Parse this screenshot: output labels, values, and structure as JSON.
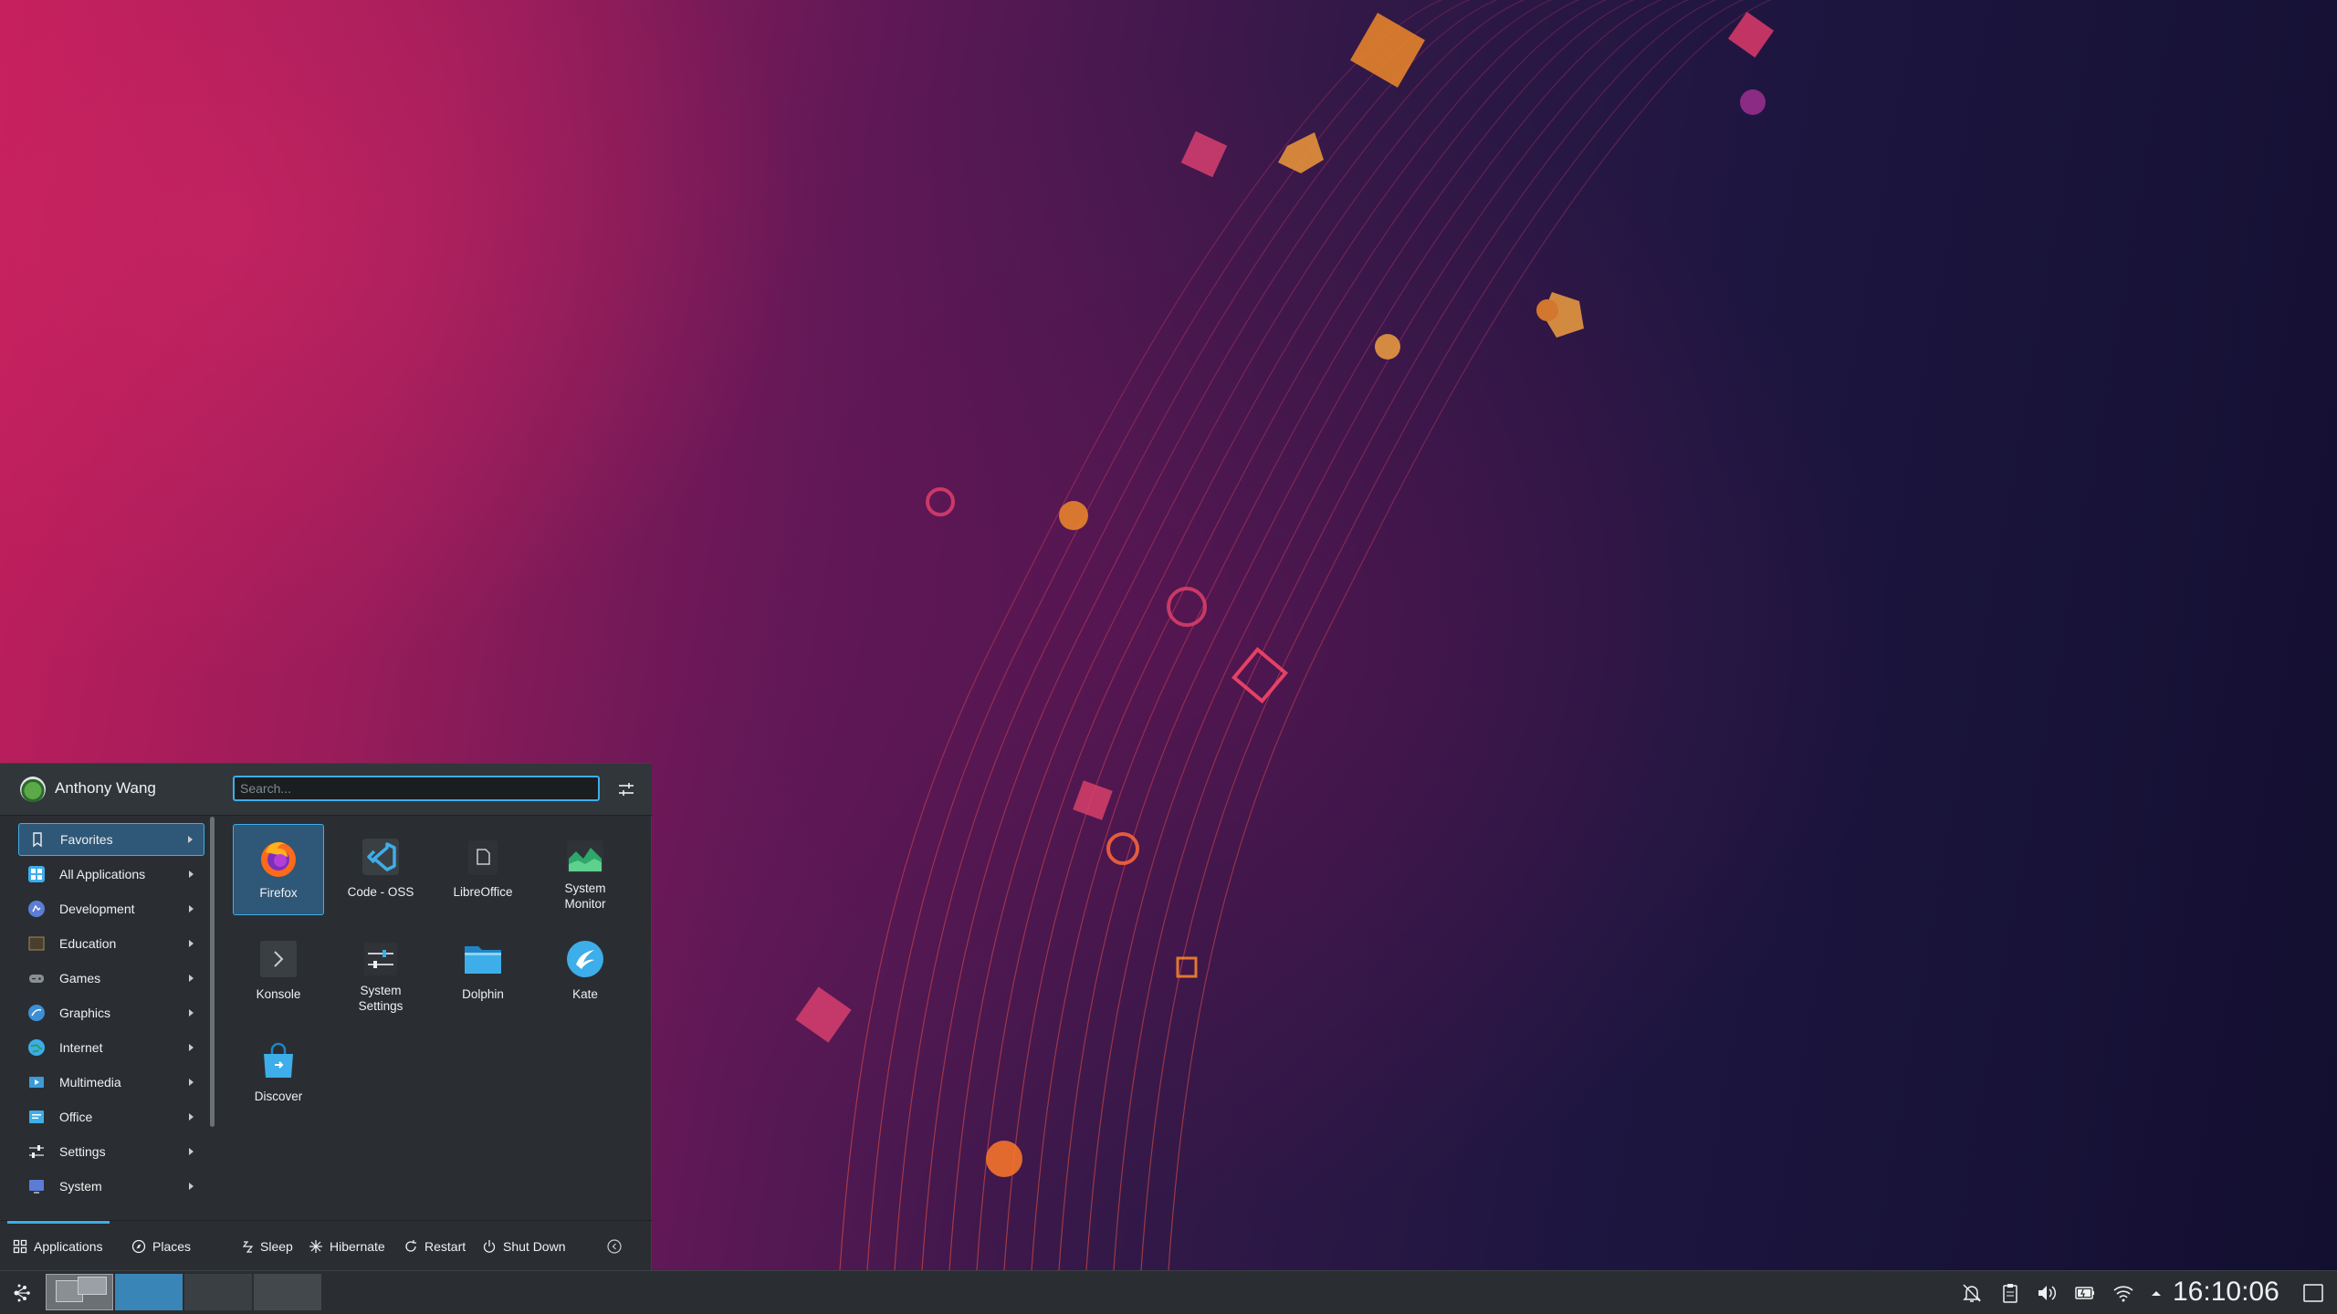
{
  "user": {
    "name": "Anthony Wang"
  },
  "search": {
    "placeholder": "Search..."
  },
  "categories": [
    {
      "label": "Favorites",
      "icon": "bookmark-icon",
      "color": "#eff0f1"
    },
    {
      "label": "All Applications",
      "icon": "grid-icon",
      "color": "#3daee9"
    },
    {
      "label": "Development",
      "icon": "development-icon",
      "color": "#5c7cd6"
    },
    {
      "label": "Education",
      "icon": "education-icon",
      "color": "#6b5a3a"
    },
    {
      "label": "Games",
      "icon": "gamepad-icon",
      "color": "#8a8f94"
    },
    {
      "label": "Graphics",
      "icon": "graphics-icon",
      "color": "#3c8fd6"
    },
    {
      "label": "Internet",
      "icon": "globe-icon",
      "color": "#3daee9"
    },
    {
      "label": "Multimedia",
      "icon": "multimedia-icon",
      "color": "#3b9bd9"
    },
    {
      "label": "Office",
      "icon": "office-icon",
      "color": "#3daee9"
    },
    {
      "label": "Settings",
      "icon": "settings-icon",
      "color": "#9aa0a6"
    },
    {
      "label": "System",
      "icon": "system-icon",
      "color": "#5c7cd6"
    }
  ],
  "apps": [
    {
      "label": "Firefox",
      "icon": "firefox-icon"
    },
    {
      "label": "Code - OSS",
      "icon": "vscode-icon"
    },
    {
      "label": "LibreOffice",
      "icon": "libreoffice-icon"
    },
    {
      "label": "System\nMonitor",
      "icon": "system-monitor-icon"
    },
    {
      "label": "Konsole",
      "icon": "terminal-icon"
    },
    {
      "label": "System\nSettings",
      "icon": "system-settings-icon"
    },
    {
      "label": "Dolphin",
      "icon": "folder-icon"
    },
    {
      "label": "Kate",
      "icon": "kate-icon"
    },
    {
      "label": "Discover",
      "icon": "store-icon"
    }
  ],
  "footer": {
    "applications": "Applications",
    "places": "Places",
    "sleep": "Sleep",
    "hibernate": "Hibernate",
    "restart": "Restart",
    "shutdown": "Shut Down"
  },
  "panel": {
    "clock": "16:10:06"
  },
  "colors": {
    "accent": "#3daee9",
    "panel": "#2a2e32",
    "selection": "#2f5778"
  }
}
